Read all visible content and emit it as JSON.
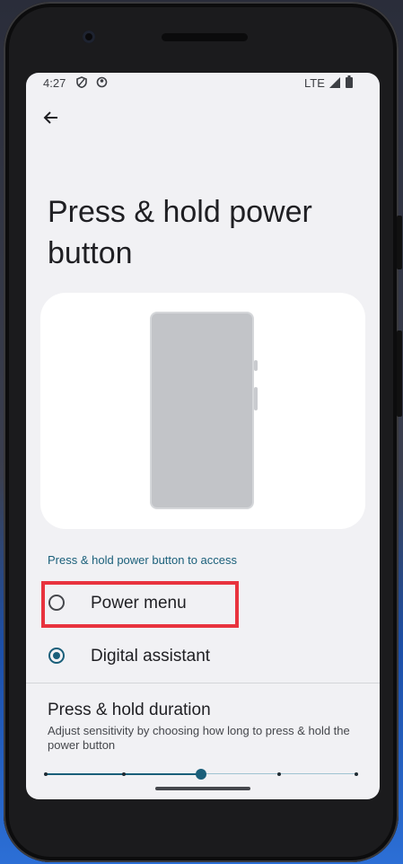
{
  "status_bar": {
    "time": "4:27",
    "network": "LTE"
  },
  "page": {
    "title": "Press & hold power button"
  },
  "section_label": "Press & hold power button to access",
  "options": [
    {
      "label": "Power menu",
      "selected": false
    },
    {
      "label": "Digital assistant",
      "selected": true
    }
  ],
  "duration": {
    "title": "Press & hold duration",
    "subtitle": "Adjust sensitivity by choosing how long to press & hold the power button",
    "steps": 5,
    "selected_step": 3
  },
  "colors": {
    "accent": "#1a5f7a",
    "highlight": "#e8333e",
    "background": "#f1f1f4"
  }
}
